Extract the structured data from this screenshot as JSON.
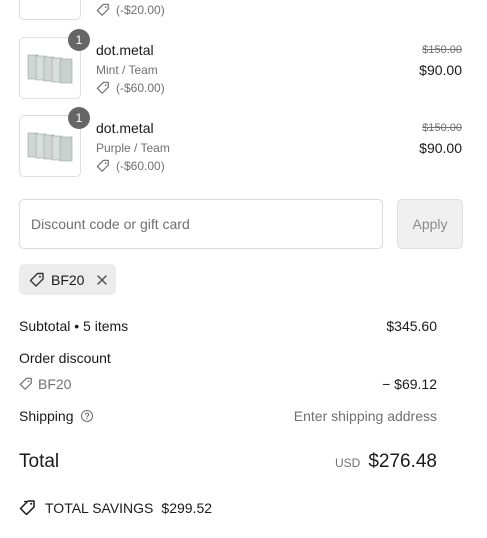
{
  "items": [
    {
      "discount": "(-$20.00)"
    },
    {
      "qty": "1",
      "name": "dot.metal",
      "variant": "Mint / Team",
      "discount": "(-$60.00)",
      "original_price": "$150.00",
      "price": "$90.00"
    },
    {
      "qty": "1",
      "name": "dot.metal",
      "variant": "Purple / Team",
      "discount": "(-$60.00)",
      "original_price": "$150.00",
      "price": "$90.00"
    }
  ],
  "discount_field": {
    "placeholder": "Discount code or gift card",
    "apply_label": "Apply"
  },
  "applied_code": "BF20",
  "summary": {
    "subtotal_label": "Subtotal • 5 items",
    "subtotal_value": "$345.60",
    "order_discount_label": "Order discount",
    "order_discount_code": "BF20",
    "order_discount_value": "− $69.12",
    "shipping_label": "Shipping",
    "shipping_value": "Enter shipping address",
    "total_label": "Total",
    "currency": "USD",
    "total_value": "$276.48",
    "savings_label": "TOTAL SAVINGS",
    "savings_value": "$299.52"
  },
  "colors": {
    "text": "#1a1a1a",
    "muted": "#707070",
    "badge": "#666666",
    "chip_bg": "#ececec",
    "border": "#d9d9d9"
  }
}
